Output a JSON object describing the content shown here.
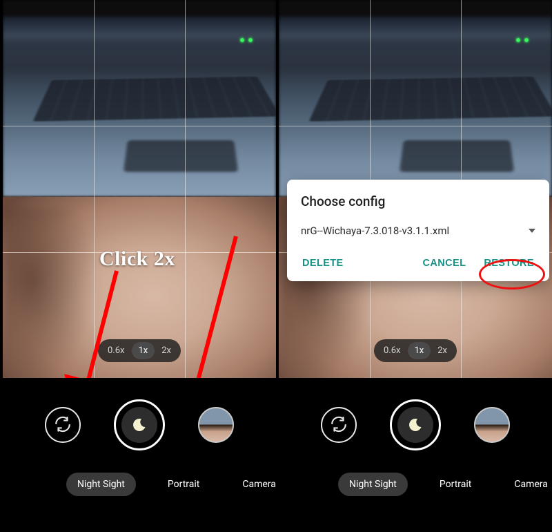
{
  "annotation": {
    "click_text": "Click 2x"
  },
  "zoom": {
    "opt1": "0.6x",
    "opt2": "1x",
    "opt3": "2x",
    "selected": "1x"
  },
  "modes": {
    "night": "Night Sight",
    "portrait": "Portrait",
    "camera": "Camera",
    "selected": "Night Sight"
  },
  "dialog": {
    "title": "Choose config",
    "selected_file": "nrG--Wichaya-7.3.018-v3.1.1.xml",
    "delete": "DELETE",
    "cancel": "CANCEL",
    "restore": "RESTORE"
  }
}
